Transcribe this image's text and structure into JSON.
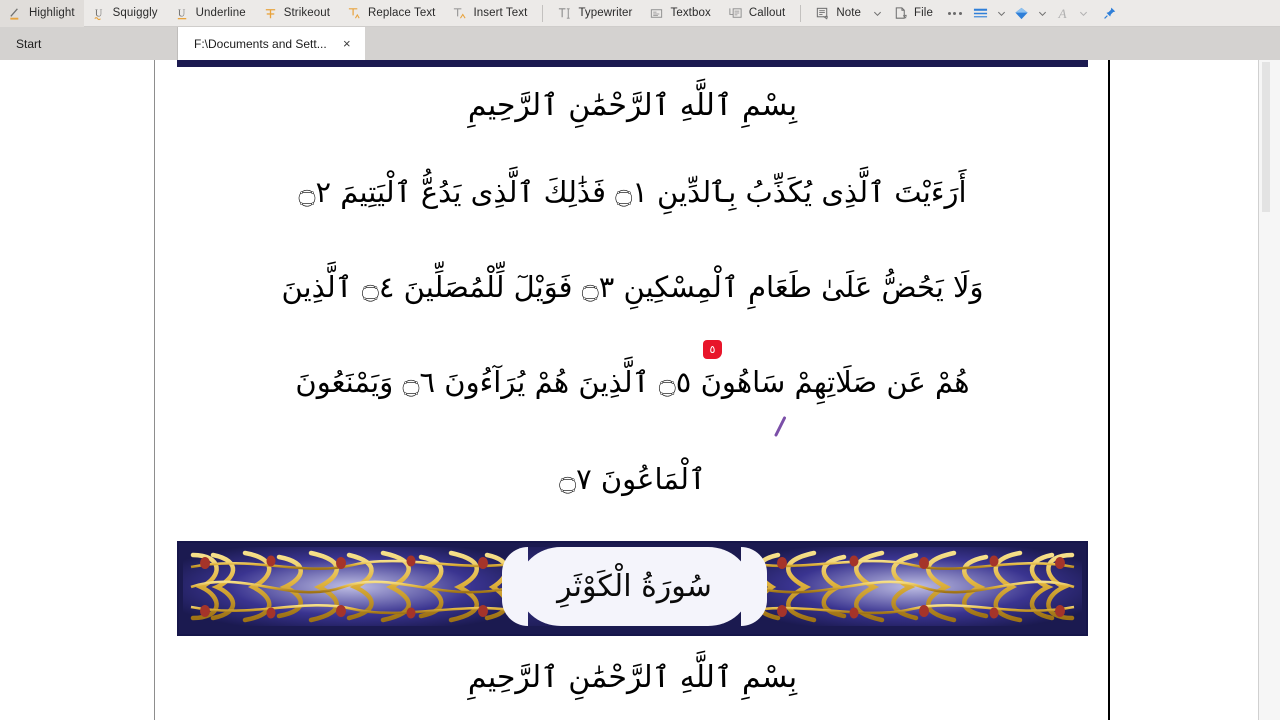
{
  "toolbar": {
    "items": [
      {
        "label": "Highlight",
        "icon": "highlight-icon"
      },
      {
        "label": "Squiggly",
        "icon": "squiggly-icon"
      },
      {
        "label": "Underline",
        "icon": "underline-icon"
      },
      {
        "label": "Strikeout",
        "icon": "strikeout-icon"
      },
      {
        "label": "Replace Text",
        "icon": "replace-text-icon"
      },
      {
        "label": "Insert Text",
        "icon": "insert-text-icon"
      },
      {
        "label": "Typewriter",
        "icon": "typewriter-icon"
      },
      {
        "label": "Textbox",
        "icon": "textbox-icon"
      },
      {
        "label": "Callout",
        "icon": "callout-icon"
      },
      {
        "label": "Note",
        "icon": "note-icon"
      },
      {
        "label": "File",
        "icon": "file-attach-icon"
      }
    ],
    "overflow_label": "More",
    "colors": {
      "accent_blue": "#2f7fd8",
      "accent_orange": "#e8a33d",
      "toolbar_bg": "#eceae8",
      "icon_gray": "#7a7a7a"
    }
  },
  "tabs": {
    "start_label": "Start",
    "documents": [
      {
        "title": "F:\\Documents and Sett...",
        "active": true,
        "close_label": "×"
      }
    ]
  },
  "document": {
    "lines": [
      {
        "id": "basmala-top",
        "text": "بِسْمِ ٱللَّهِ ٱلرَّحْمَٰنِ ٱلرَّحِيمِ"
      },
      {
        "id": "ayah-1-2",
        "text": "أَرَءَيْتَ ٱلَّذِى يُكَذِّبُ بِٱلدِّينِ ۝١ فَذَٰلِكَ ٱلَّذِى يَدُعُّ ٱلْيَتِيمَ ۝٢"
      },
      {
        "id": "ayah-3-4",
        "text": "وَلَا يَحُضُّ عَلَىٰ طَعَامِ ٱلْمِسْكِينِ ۝٣ فَوَيْلٓ لِّلْمُصَلِّينَ ۝٤ ٱلَّذِينَ"
      },
      {
        "id": "ayah-5-6",
        "text": "هُمْ عَن صَلَاتِهِمْ سَاهُونَ ۝٥ ٱلَّذِينَ هُمْ يُرَآءُونَ ۝٦ وَيَمْنَعُونَ"
      },
      {
        "id": "ayah-7",
        "text": "ٱلْمَاعُونَ ۝٧"
      },
      {
        "id": "basmala-bottom",
        "text": "بِسْمِ ٱللَّهِ ٱلرَّحْمَٰنِ ٱلرَّحِيمِ"
      }
    ],
    "surah_banner": {
      "title": "سُورَةُ الْكَوْثَرِ",
      "colors": {
        "navy": "#1b1a50",
        "gold": "#e8c04a",
        "red": "#a5342a",
        "cartouche": "#f4f4fb"
      }
    },
    "annotations": [
      {
        "type": "note-marker",
        "label": "٥",
        "color": "#e8152a"
      },
      {
        "type": "pen-stroke",
        "color": "#7b4fa8"
      }
    ]
  }
}
